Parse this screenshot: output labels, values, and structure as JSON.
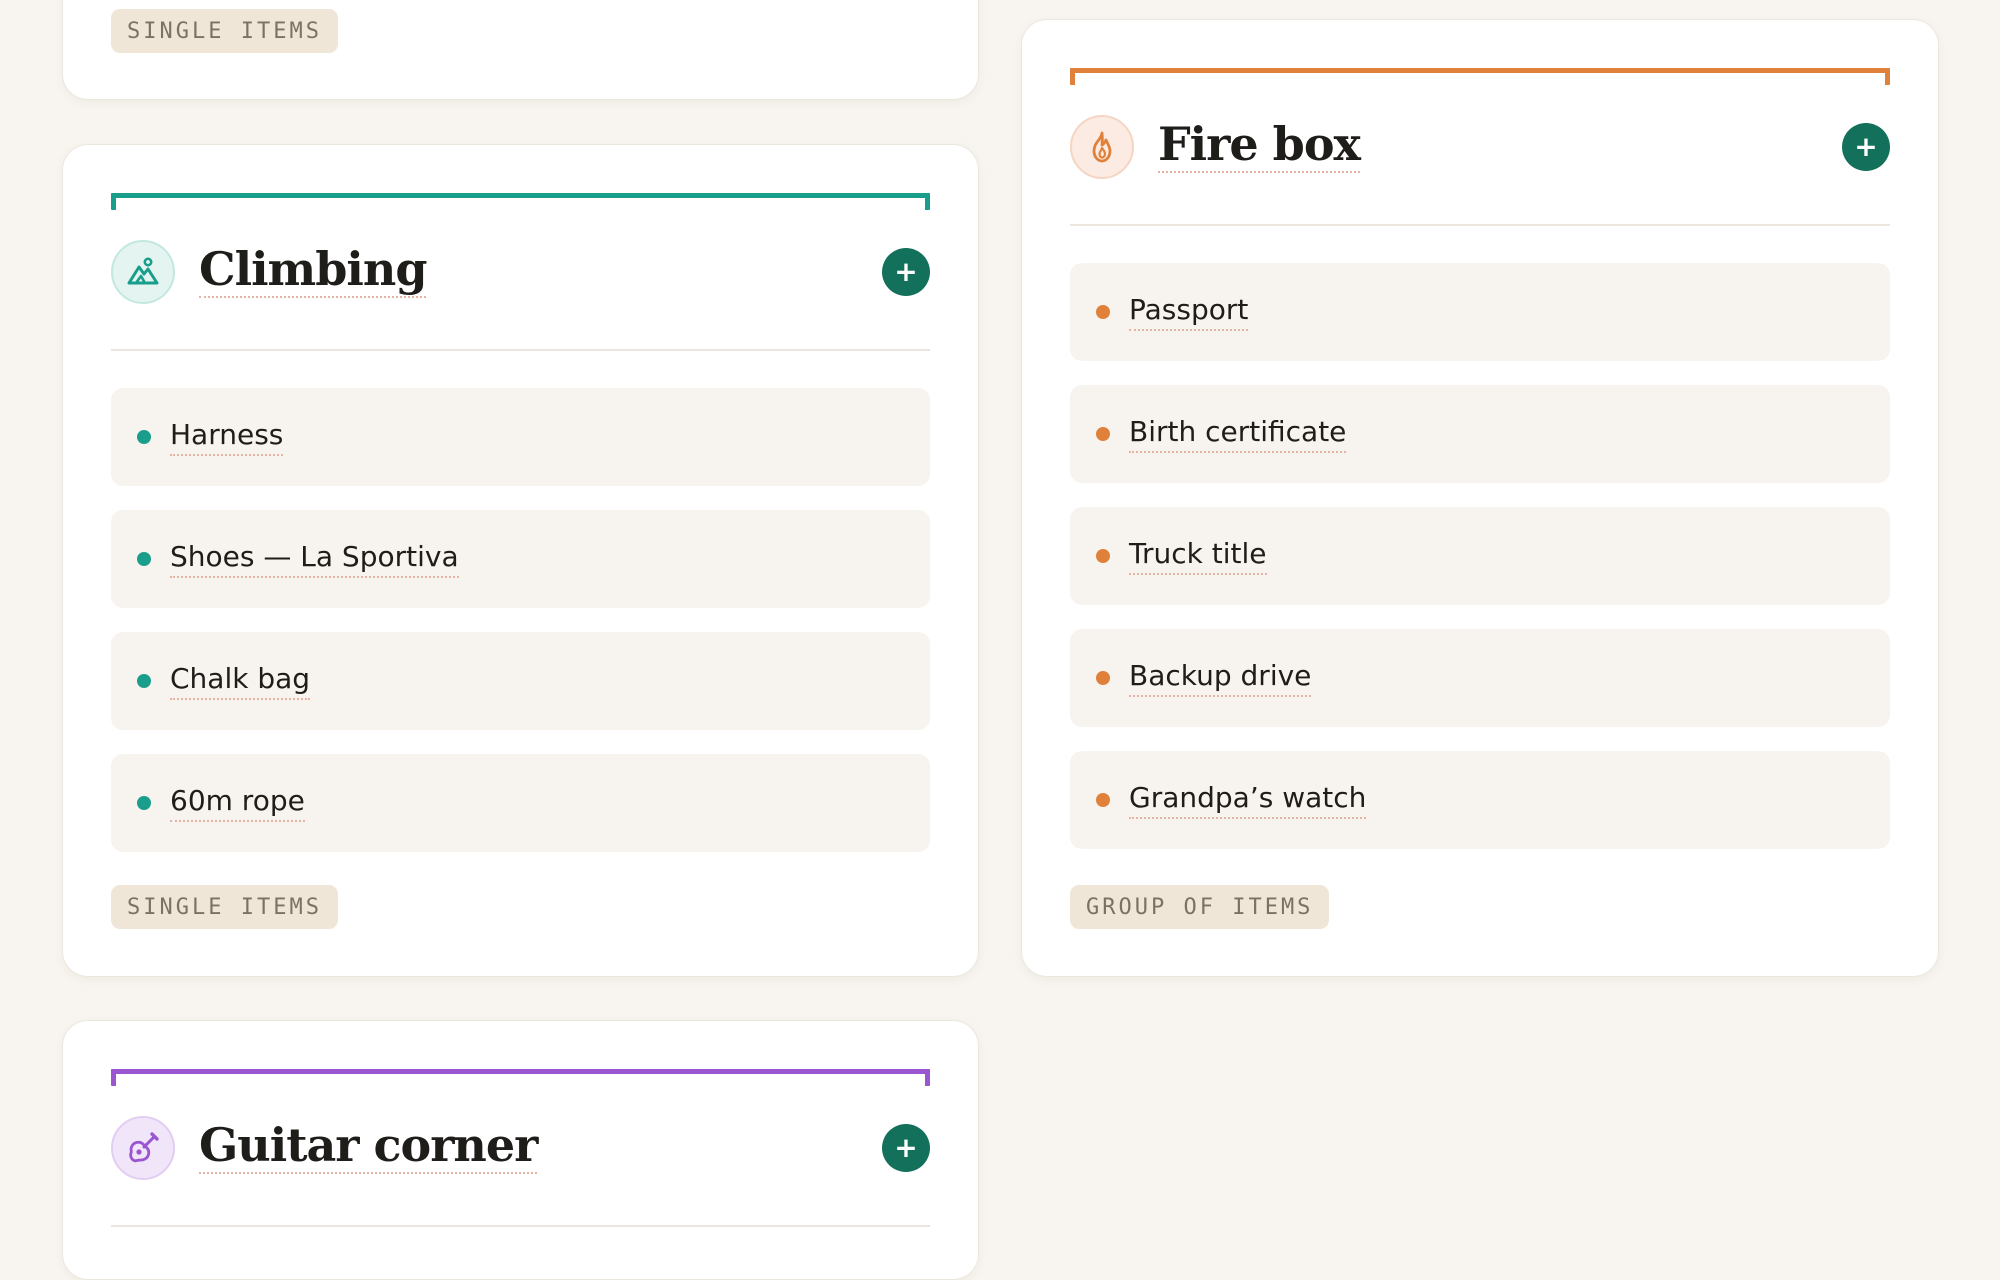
{
  "colors": {
    "background": "#f8f5f0",
    "add_button": "#13705a",
    "climbing_accent": "#1a9e8c",
    "firebox_accent": "#e0813b",
    "guitar_accent": "#9a55d0"
  },
  "cards": {
    "top_partial": {
      "tag": "SINGLE ITEMS"
    },
    "climbing": {
      "title": "Climbing",
      "icon": "mountain-icon",
      "add_label": "+",
      "items": [
        {
          "label": "Harness"
        },
        {
          "label": "Shoes — La Sportiva"
        },
        {
          "label": "Chalk bag"
        },
        {
          "label": "60m rope"
        }
      ],
      "tag": "SINGLE ITEMS"
    },
    "firebox": {
      "title": "Fire box",
      "icon": "flame-icon",
      "add_label": "+",
      "items": [
        {
          "label": "Passport"
        },
        {
          "label": "Birth certificate"
        },
        {
          "label": "Truck title"
        },
        {
          "label": "Backup drive"
        },
        {
          "label": "Grandpa’s watch"
        }
      ],
      "tag": "GROUP OF ITEMS"
    },
    "guitar": {
      "title": "Guitar corner",
      "icon": "guitar-icon",
      "add_label": "+"
    }
  }
}
